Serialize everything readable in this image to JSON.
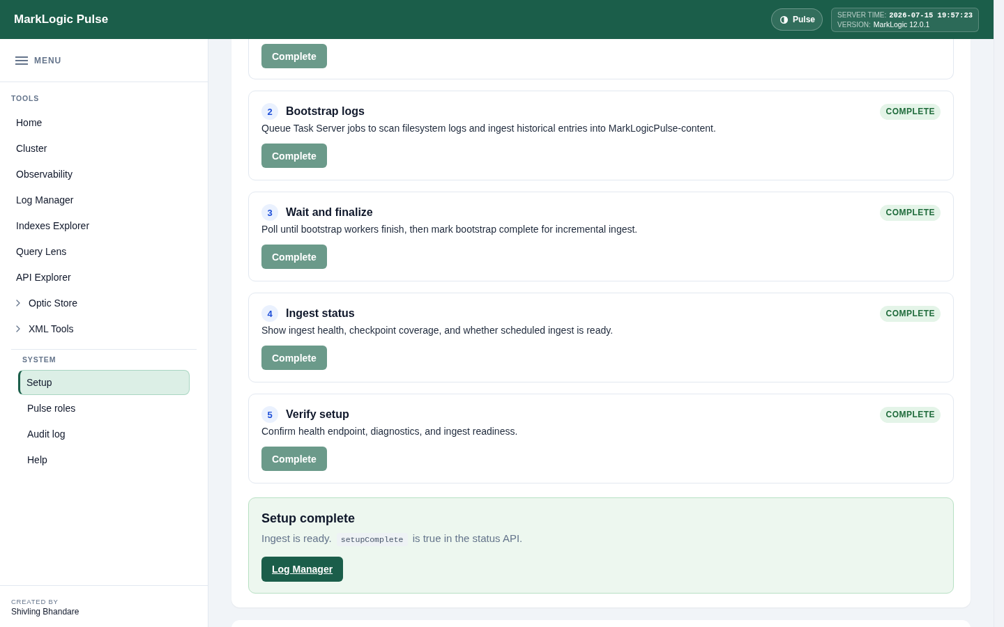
{
  "header": {
    "title": "MarkLogic Pulse",
    "pulse_button": {
      "label": "Pulse"
    },
    "server_info": {
      "server_time_label": "SERVER TIME:",
      "server_time": "2026-07-15 19:57:23",
      "version_label": "VERSION:",
      "version": "MarkLogic 12.0.1"
    }
  },
  "sidebar": {
    "menu_label": "MENU",
    "sections": [
      {
        "title": "TOOLS",
        "items": [
          {
            "label": "Home",
            "kind": "link",
            "selected": false
          },
          {
            "label": "Cluster",
            "kind": "link",
            "selected": false
          },
          {
            "label": "Observability",
            "kind": "link",
            "selected": false
          },
          {
            "label": "Log Manager",
            "kind": "link",
            "selected": false
          },
          {
            "label": "Indexes Explorer",
            "kind": "link",
            "selected": false
          },
          {
            "label": "Query Lens",
            "kind": "link",
            "selected": false
          },
          {
            "label": "API Explorer",
            "kind": "link",
            "selected": false
          },
          {
            "label": "Optic Store",
            "kind": "group",
            "selected": false,
            "expanded": false
          },
          {
            "label": "XML Tools",
            "kind": "group",
            "selected": false,
            "expanded": false
          }
        ]
      },
      {
        "title": "SYSTEM",
        "items": [
          {
            "label": "Setup",
            "kind": "link",
            "selected": true
          },
          {
            "label": "Pulse roles",
            "kind": "link",
            "selected": false
          },
          {
            "label": "Audit log",
            "kind": "link",
            "selected": false
          },
          {
            "label": "Help",
            "kind": "link",
            "selected": false
          }
        ]
      }
    ],
    "footer": {
      "label": "CREATED BY",
      "name": "Shivling Bhandare"
    }
  },
  "steps": [
    {
      "button": {
        "label": "Complete",
        "disabled": true
      }
    },
    {
      "number": "2",
      "title": "Bootstrap logs",
      "description": "Queue Task Server jobs to scan filesystem logs and ingest historical entries into MarkLogicPulse-content.",
      "status": "COMPLETE",
      "button": {
        "label": "Complete",
        "disabled": true
      }
    },
    {
      "number": "3",
      "title": "Wait and finalize",
      "description": "Poll until bootstrap workers finish, then mark bootstrap complete for incremental ingest.",
      "status": "COMPLETE",
      "button": {
        "label": "Complete",
        "disabled": true
      }
    },
    {
      "number": "4",
      "title": "Ingest status",
      "description": "Show ingest health, checkpoint coverage, and whether scheduled ingest is ready.",
      "status": "COMPLETE",
      "button": {
        "label": "Complete",
        "disabled": true
      }
    },
    {
      "number": "5",
      "title": "Verify setup",
      "description": "Confirm health endpoint, diagnostics, and ingest readiness.",
      "status": "COMPLETE",
      "button": {
        "label": "Complete",
        "disabled": true
      }
    }
  ],
  "completion_panel": {
    "title": "Setup complete",
    "text_before": "Ingest is ready.",
    "code": "setupComplete",
    "text_after": "is true in the status API.",
    "button": "Log Manager"
  }
}
